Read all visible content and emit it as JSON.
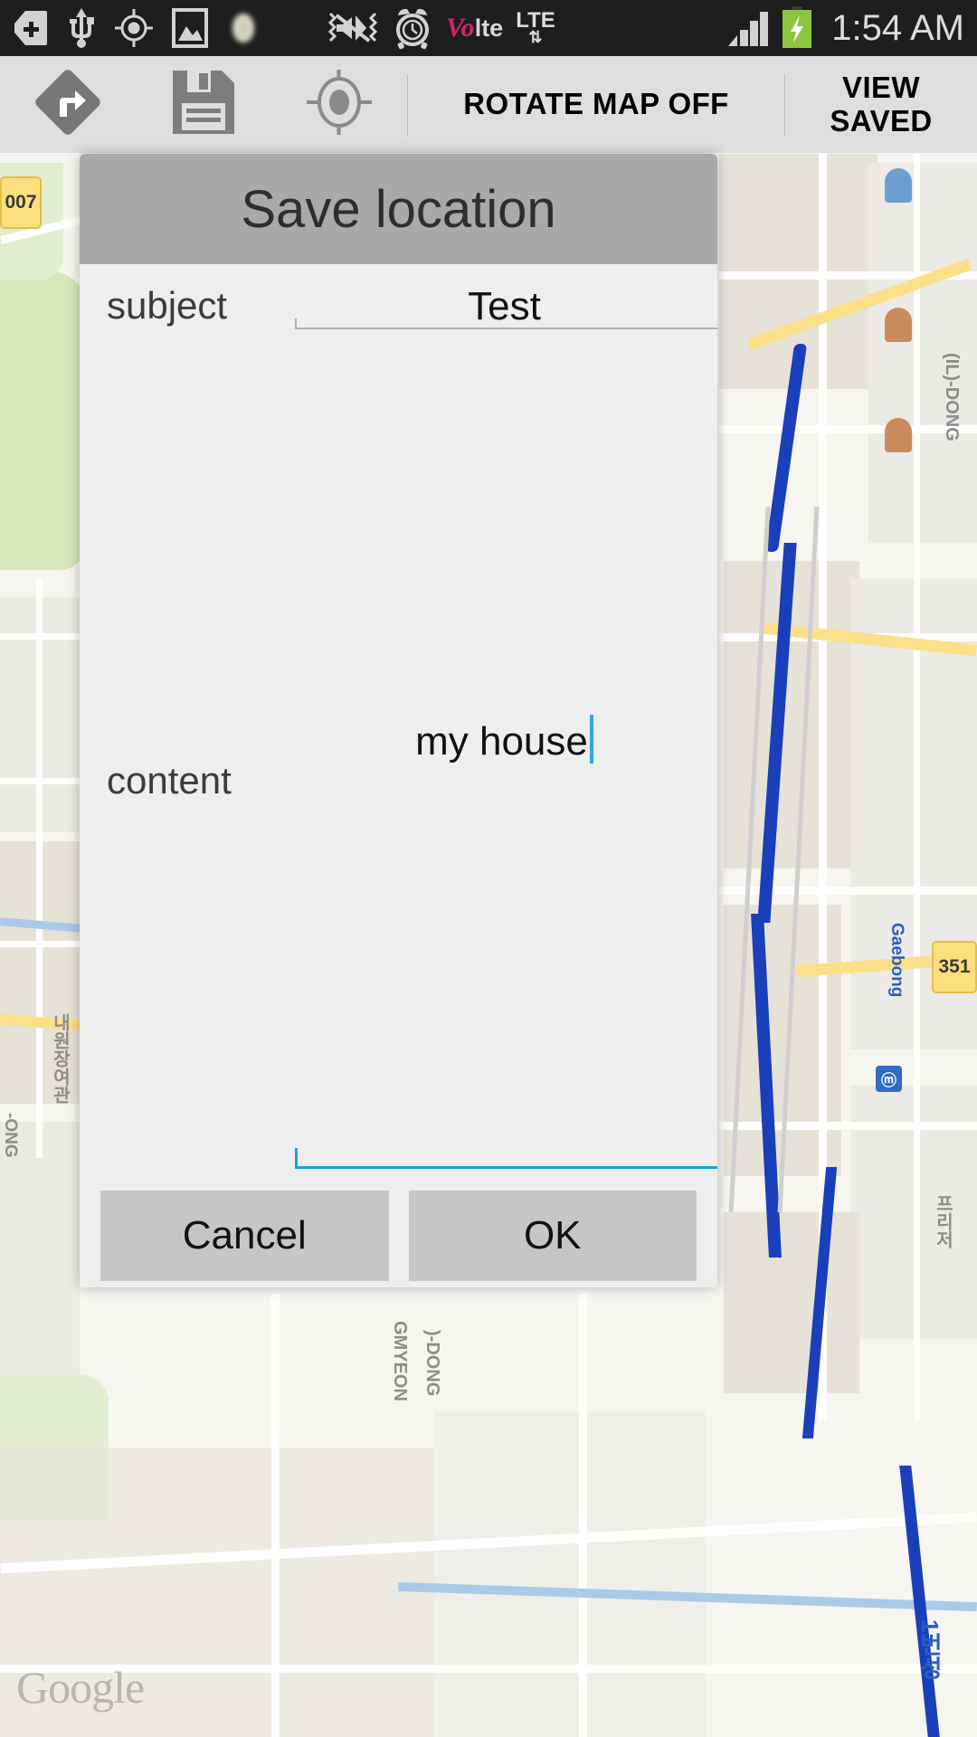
{
  "status_bar": {
    "time": "1:54 AM",
    "network_label": "LTE",
    "volte_label_1": "Vo",
    "volte_label_2": "lte",
    "icons": [
      "sd-card-add-icon",
      "usb-icon",
      "gps-location-icon",
      "screenshot-image-icon",
      "unknown-blur-icon",
      "sound-mute-vibrate-icon",
      "alarm-clock-icon",
      "volte-icon",
      "lte-data-icon",
      "signal-bars-icon",
      "battery-charging-icon"
    ]
  },
  "toolbar": {
    "directions_icon": "directions-turn-right-icon",
    "save_icon": "floppy-disk-save-icon",
    "my_location_icon": "gps-crosshair-icon",
    "rotate_map_label": "ROTATE MAP OFF",
    "view_saved_label_line1": "VIEW",
    "view_saved_label_line2": "SAVED"
  },
  "dialog": {
    "title": "Save location",
    "fields": [
      {
        "label": "subject",
        "value": "Test",
        "focused": false
      },
      {
        "label": "content",
        "value": "my house",
        "focused": true
      }
    ],
    "buttons": {
      "cancel": "Cancel",
      "ok": "OK"
    }
  },
  "map": {
    "watermark": "Google",
    "road_shields": [
      "007",
      "351"
    ],
    "labels": [
      "(IL)-DONG",
      "Gaebong",
      "내원장여관",
      "프리저",
      "GMYEON",
      ")-DONG",
      "-ONG",
      "1번성"
    ]
  },
  "colors": {
    "accent_blue": "#17a3db",
    "caret_blue": "#29abe2",
    "dialog_header": "#a9a9a9",
    "dialog_body": "#eeeeee",
    "button_gray": "#c6c6c6",
    "toolbar_gray": "#dedede",
    "statusbar_black": "#1e1e1e",
    "battery_green": "#8cc63f"
  }
}
